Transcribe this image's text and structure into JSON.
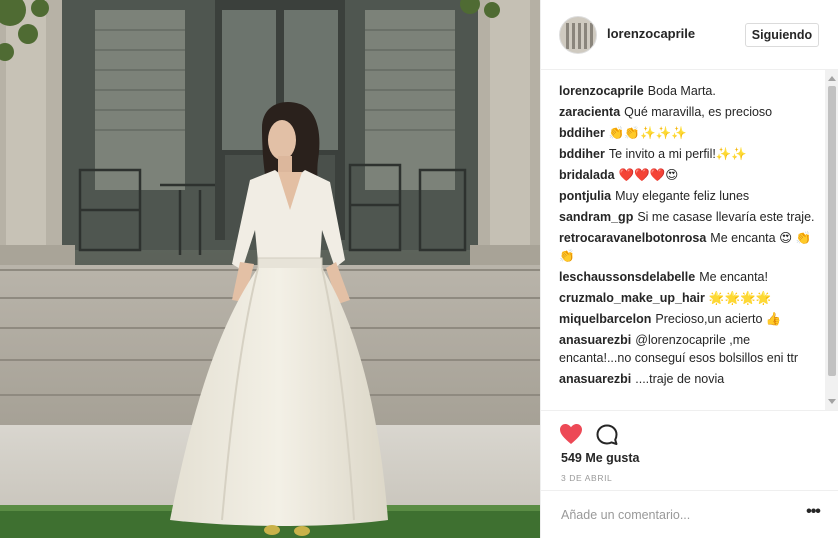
{
  "post": {
    "username": "lorenzocaprile",
    "follow_label": "Siguiendo",
    "photo_subject": "woman-in-white-dress-photo"
  },
  "comments": [
    {
      "user": "lorenzocaprile",
      "text": "Boda Marta."
    },
    {
      "user": "zaracienta",
      "text": "Qué maravilla, es precioso"
    },
    {
      "user": "bddiher",
      "text": "👏👏✨✨✨"
    },
    {
      "user": "bddiher",
      "text": "Te invito a mi perfil!✨✨"
    },
    {
      "user": "bridalada",
      "text": "❤️❤️❤️😍"
    },
    {
      "user": "pontjulia",
      "text": "Muy elegante feliz lunes"
    },
    {
      "user": "sandram_gp",
      "text": "Si me casase llevaría este traje."
    },
    {
      "user": "retrocaravanelbotonrosa",
      "text": "Me encanta 😍 👏👏"
    },
    {
      "user": "leschaussonsdelabelle",
      "text": "Me encanta!"
    },
    {
      "user": "cruzmalo_make_up_hair",
      "text": "🌟🌟🌟🌟"
    },
    {
      "user": "miquelbarcelon",
      "text": "Precioso,un acierto 👍"
    },
    {
      "user": "anasuarezbi",
      "text": "@lorenzocaprile ,me encanta!...no conseguí esos bolsillos eni ttr"
    },
    {
      "user": "anasuarezbi",
      "text": "....traje de novia"
    }
  ],
  "actions": {
    "likes_label": "549 Me gusta",
    "date_label": "3 DE ABRIL",
    "like_icon": "heart-icon",
    "comment_icon": "comment-bubble-icon"
  },
  "add_comment": {
    "placeholder": "Añade un comentario...",
    "more_label": "•••"
  },
  "colors": {
    "heart": "#ed4956",
    "border": "#efefef",
    "muted": "#999999",
    "text": "#262626"
  }
}
